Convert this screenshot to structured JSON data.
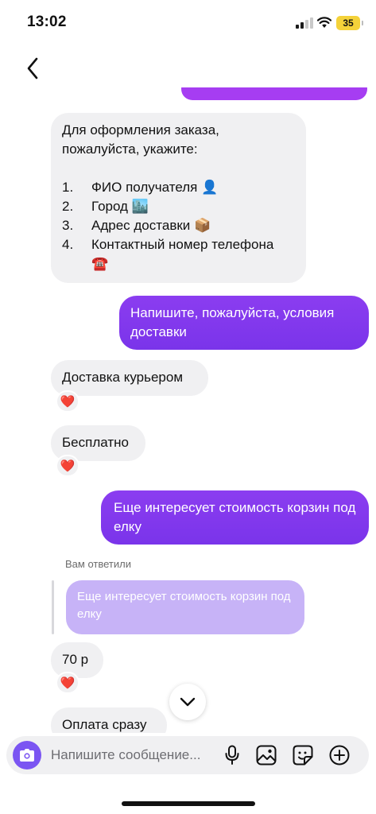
{
  "status_bar": {
    "time": "13:02",
    "battery": "35",
    "icons": [
      "signal-icon",
      "wifi-icon",
      "battery-icon"
    ]
  },
  "header": {
    "back_icon": "chevron-left-icon"
  },
  "messages": {
    "order_request": {
      "intro_line1": "Для оформления заказа,",
      "intro_line2": "пожалуйста, укажите:",
      "items": [
        {
          "num": "1.",
          "text": "ФИО получателя 👤"
        },
        {
          "num": "2.",
          "text": "Город 🏙️"
        },
        {
          "num": "3.",
          "text": "Адрес доставки 📦"
        },
        {
          "num": "4.",
          "text": "Контактный номер телефона ☎️"
        }
      ]
    },
    "ask_delivery": "Напишите, пожалуйста, условия доставки",
    "courier": "Доставка курьером",
    "free": "Бесплатно",
    "ask_price": "Еще интересует стоимость корзин под елку",
    "reply_label": "Вам ответили",
    "reply_quote": "Еще интересует стоимость корзин под елку",
    "price": "70 р",
    "payment": "Оплата сразу",
    "reaction": "❤️"
  },
  "composer": {
    "placeholder": "Напишите сообщение...",
    "icons": [
      "camera-icon",
      "microphone-icon",
      "image-icon",
      "sticker-icon",
      "plus-icon"
    ]
  },
  "colors": {
    "outgoing_bubble": "#7c3aed",
    "incoming_bubble": "#f0f0f2",
    "reply_quote": "#c7b3f7",
    "camera_button": "#7b55f2",
    "battery": "#f4d23a"
  }
}
